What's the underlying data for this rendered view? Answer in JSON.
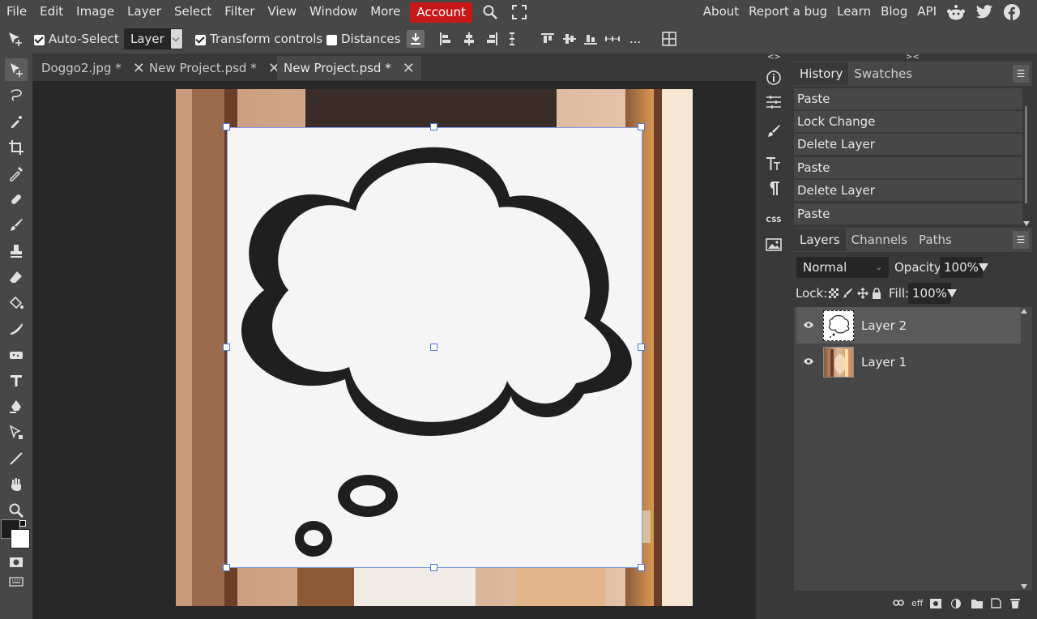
{
  "menubar": {
    "items": [
      "File",
      "Edit",
      "Image",
      "Layer",
      "Select",
      "Filter",
      "View",
      "Window",
      "More"
    ],
    "account": "Account",
    "right_links": [
      "About",
      "Report a bug",
      "Learn",
      "Blog",
      "API"
    ],
    "accent": "#c81717"
  },
  "options": {
    "auto_select": "Auto-Select",
    "auto_select_checked": true,
    "target": "Layer",
    "transform_controls": "Transform controls",
    "transform_checked": true,
    "distances": "Distances",
    "distances_checked": false,
    "more": "..."
  },
  "tabs": [
    {
      "label": "Doggo2.jpg *",
      "active": false
    },
    {
      "label": "New Project.psd *",
      "active": false
    },
    {
      "label": "New Project.psd *",
      "active": true
    }
  ],
  "tools": [
    "move-icon",
    "lasso-icon",
    "quick-select-icon",
    "crop-icon",
    "eyedropper-icon",
    "healing-icon",
    "brush-icon",
    "stamp-icon",
    "eraser-icon",
    "fill-icon",
    "smudge-icon",
    "sponge-icon",
    "text-icon",
    "pen-icon",
    "path-select-icon",
    "line-icon",
    "hand-icon",
    "zoom-icon"
  ],
  "colors": {
    "foreground": "#1e1e1e",
    "background": "#ffffff"
  },
  "side_buttons": [
    "info-icon",
    "adjustments-icon",
    "brush-settings-icon",
    "character-icon",
    "paragraph-icon",
    "css-icon",
    "image-icon"
  ],
  "side_css_label": "CSS",
  "history": {
    "tabs": [
      "History",
      "Swatches"
    ],
    "items": [
      "Paste",
      "Lock Change",
      "Delete Layer",
      "Paste",
      "Delete Layer",
      "Paste"
    ]
  },
  "layers_panel": {
    "tabs": [
      "Layers",
      "Channels",
      "Paths"
    ],
    "blend_mode": "Normal",
    "opacity_label": "Opacity:",
    "opacity": "100%",
    "lock_label": "Lock:",
    "fill_label": "Fill:",
    "fill": "100%",
    "layers": [
      {
        "name": "Layer 2",
        "selected": true
      },
      {
        "name": "Layer 1",
        "selected": false
      }
    ],
    "footer": [
      "link-icon",
      "effects-icon",
      "mask-icon",
      "adjustment-layer-icon",
      "folder-icon",
      "new-layer-icon",
      "trash-icon"
    ],
    "footer_eff": "eff"
  },
  "panel_collapse": {
    "left": "<>",
    "right": "><"
  }
}
